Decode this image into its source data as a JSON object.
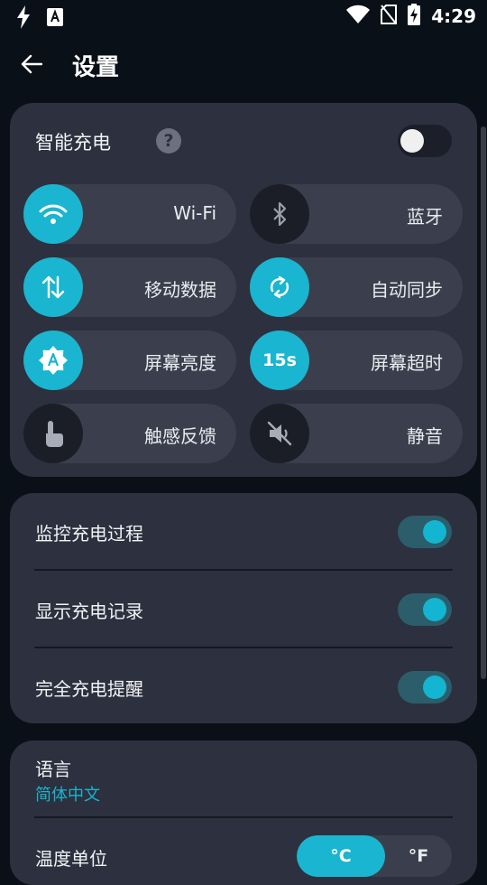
{
  "status_bar": {
    "time": "4:29",
    "left_icons": [
      "flash-icon",
      "keyboard-a-icon"
    ],
    "right_icons": [
      "wifi-icon",
      "no-sim-icon",
      "battery-charging-icon"
    ]
  },
  "header": {
    "title": "设置"
  },
  "smart_charge": {
    "label": "智能充电",
    "help": "?",
    "enabled": false
  },
  "tiles": [
    {
      "label": "Wi-Fi",
      "icon": "wifi-icon",
      "active": true
    },
    {
      "label": "蓝牙",
      "icon": "bluetooth-icon",
      "active": false
    },
    {
      "label": "移动数据",
      "icon": "mobile-data-icon",
      "active": true
    },
    {
      "label": "自动同步",
      "icon": "sync-icon",
      "active": true
    },
    {
      "label": "屏幕亮度",
      "icon": "brightness-auto-icon",
      "active": true
    },
    {
      "label": "屏幕超时",
      "badge": "15s",
      "active": true
    },
    {
      "label": "触感反馈",
      "icon": "touch-icon",
      "active": false
    },
    {
      "label": "静音",
      "icon": "volume-mute-icon",
      "active": false
    }
  ],
  "charge_settings": [
    {
      "label": "监控充电过程",
      "enabled": true
    },
    {
      "label": "显示充电记录",
      "enabled": true
    },
    {
      "label": "完全充电提醒",
      "enabled": true
    }
  ],
  "language": {
    "label": "语言",
    "value": "简体中文"
  },
  "temperature": {
    "label": "温度单位",
    "options": [
      "°C",
      "°F"
    ],
    "selected": "°C"
  },
  "colors": {
    "accent": "#1ab5d0",
    "card": "#2d303e",
    "background": "#0a1017",
    "tile": "#3b3f4d"
  }
}
